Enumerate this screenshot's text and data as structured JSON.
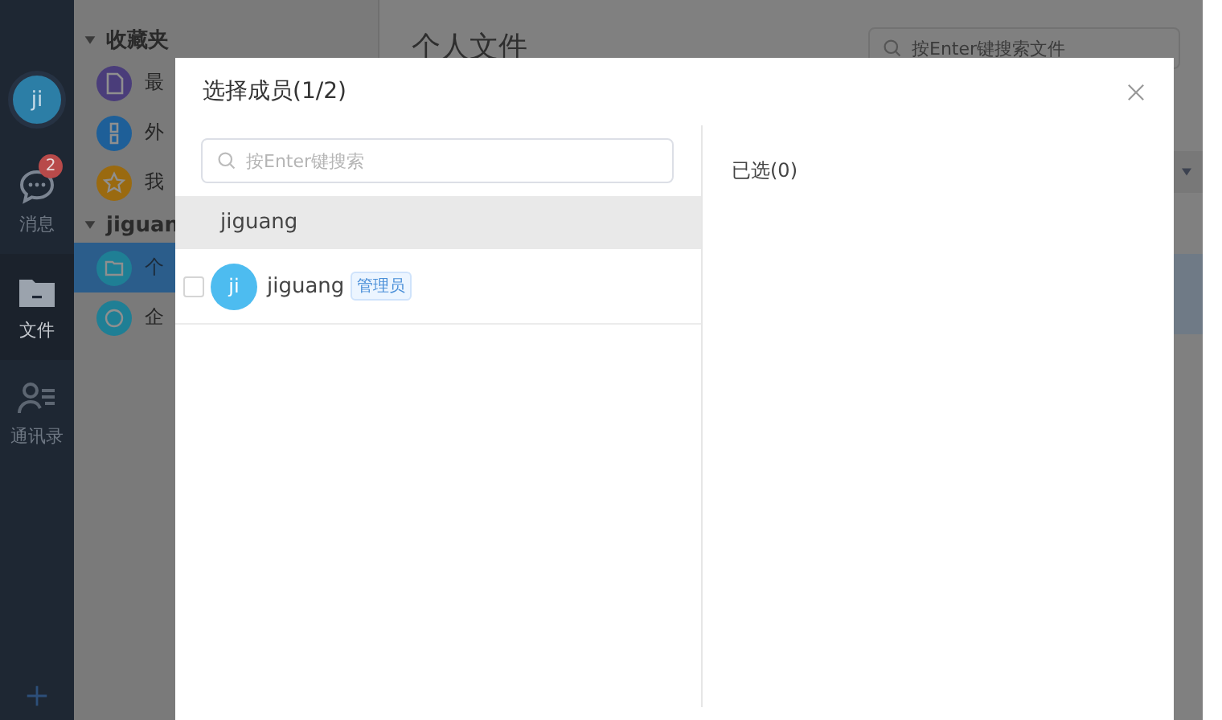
{
  "rail": {
    "avatar": "ji",
    "items": [
      {
        "kind": "chat",
        "label": "消息",
        "badge": "2",
        "selected": false
      },
      {
        "kind": "folder",
        "label": "文件",
        "selected": true
      },
      {
        "kind": "contacts",
        "label": "通讯录",
        "selected": false
      }
    ]
  },
  "sidebar": {
    "sections": [
      {
        "title": "收藏夹",
        "expanded": true,
        "items": [
          {
            "kind": "doc",
            "label": "最",
            "color": "#4a3d7a",
            "selected": false
          },
          {
            "kind": "link",
            "label": "外",
            "color": "#1e5f98",
            "selected": false
          },
          {
            "kind": "star",
            "label": "我",
            "color": "#9a6a10",
            "selected": false
          }
        ]
      },
      {
        "title": "jiguan",
        "expanded": true,
        "items": [
          {
            "kind": "folder",
            "label": "个",
            "color": "#1f7f95",
            "selected": true
          },
          {
            "kind": "globe",
            "label": "企",
            "color": "#1f7f95",
            "selected": false
          }
        ]
      }
    ]
  },
  "main": {
    "title": "个人文件",
    "search": {
      "placeholder": "按Enter键搜索文件"
    }
  },
  "dialog": {
    "title": "选择成员(1/2)",
    "search": {
      "placeholder": "按Enter键搜索"
    },
    "groups": [
      {
        "name": "jiguang",
        "selected": true
      }
    ],
    "members": [
      {
        "avatar": "ji",
        "name": "jiguang",
        "role": "管理员",
        "checked": false
      }
    ],
    "selected_title": "已选(0)"
  }
}
